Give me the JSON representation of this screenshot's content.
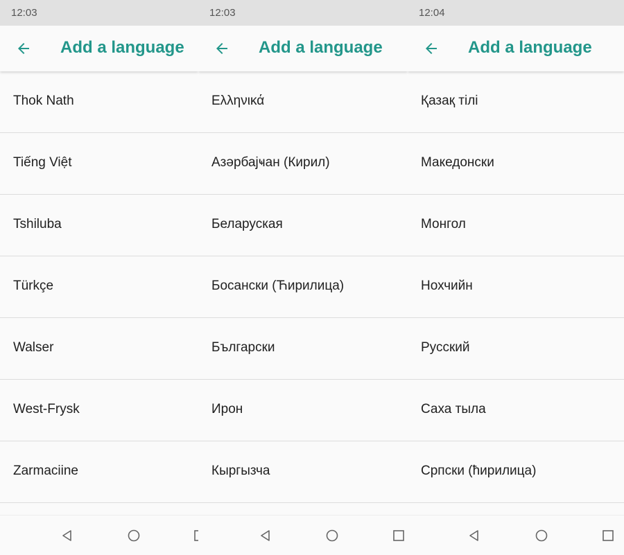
{
  "panels": [
    {
      "time": "12:03",
      "title": "Add a language",
      "languages": [
        "Thok Nath",
        "Tiếng Việt",
        "Tshiluba",
        "Türkçe",
        "Walser",
        "West-Frysk",
        "Zarmaciine"
      ]
    },
    {
      "time": "12:03",
      "title": "Add a language",
      "languages": [
        "Ελληνικά",
        "Азәрбајҹан (Кирил)",
        "Беларуская",
        "Босански (Ћирилица)",
        "Български",
        "Ирон",
        "Кыргызча"
      ]
    },
    {
      "time": "12:04",
      "title": "Add a language",
      "languages": [
        "Қазақ тілі",
        "Македонски",
        "Монгол",
        "Нохчийн",
        "Русский",
        "Саха тыла",
        "Српски (ћирилица)"
      ]
    }
  ],
  "icons": {
    "back": "arrow-back-icon",
    "nav_back": "triangle-back-icon",
    "nav_home": "circle-home-icon",
    "nav_recents": "square-recents-icon"
  },
  "colors": {
    "accent": "#22968a",
    "status_bar": "#e1e1e1",
    "background": "#fafafa",
    "divider": "#dcdcdc"
  }
}
